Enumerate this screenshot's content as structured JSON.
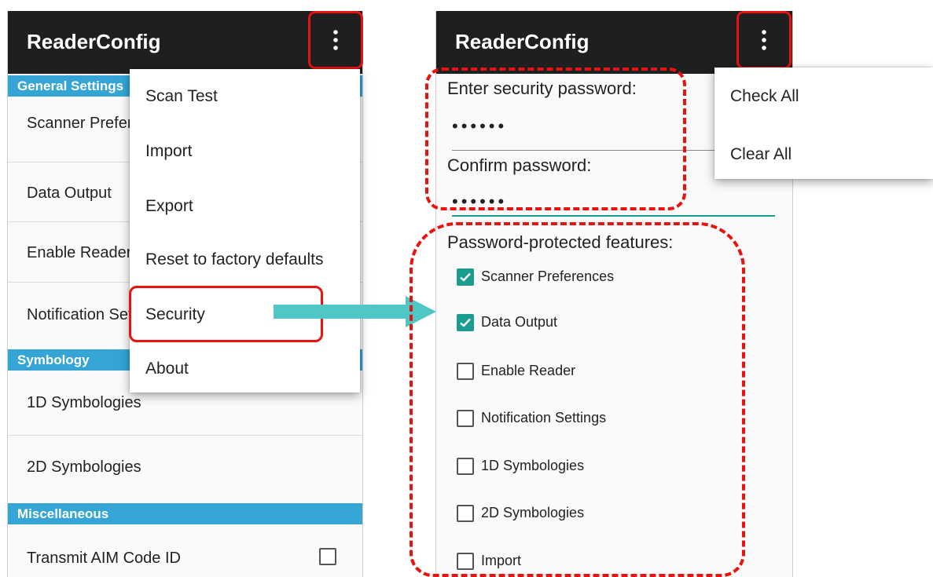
{
  "left": {
    "app_title": "ReaderConfig",
    "section_general": "General Settings",
    "general_items": [
      "Scanner Preferences",
      "Data Output",
      "Enable Reader",
      "Notification Settings"
    ],
    "section_symbology": "Symbology",
    "symbology_items": [
      "1D Symbologies",
      "2D Symbologies"
    ],
    "section_misc": "Miscellaneous",
    "misc_item": "Transmit AIM Code ID",
    "misc_item_checked": false,
    "overflow_icon": "more-vert-icon",
    "menu": [
      "Scan Test",
      "Import",
      "Export",
      "Reset to factory defaults",
      "Security",
      "About"
    ]
  },
  "right": {
    "app_title": "ReaderConfig",
    "overflow_icon": "more-vert-icon",
    "password_label": "Enter security password:",
    "password_value": "••••••",
    "confirm_label": "Confirm password:",
    "confirm_value": "••••••",
    "features_label": "Password-protected features:",
    "features": [
      {
        "label": "Scanner Preferences",
        "checked": true
      },
      {
        "label": "Data Output",
        "checked": true
      },
      {
        "label": "Enable Reader",
        "checked": false
      },
      {
        "label": "Notification Settings",
        "checked": false
      },
      {
        "label": "1D Symbologies",
        "checked": false
      },
      {
        "label": "2D Symbologies",
        "checked": false
      },
      {
        "label": "Import",
        "checked": false
      }
    ],
    "menu": [
      "Check All",
      "Clear All"
    ]
  },
  "colors": {
    "appbar": "#1f1f1f",
    "section_header": "#35a5d6",
    "accent": "#1a9c8f",
    "highlight": "#e8120f",
    "arrow": "#4fc7c7"
  }
}
